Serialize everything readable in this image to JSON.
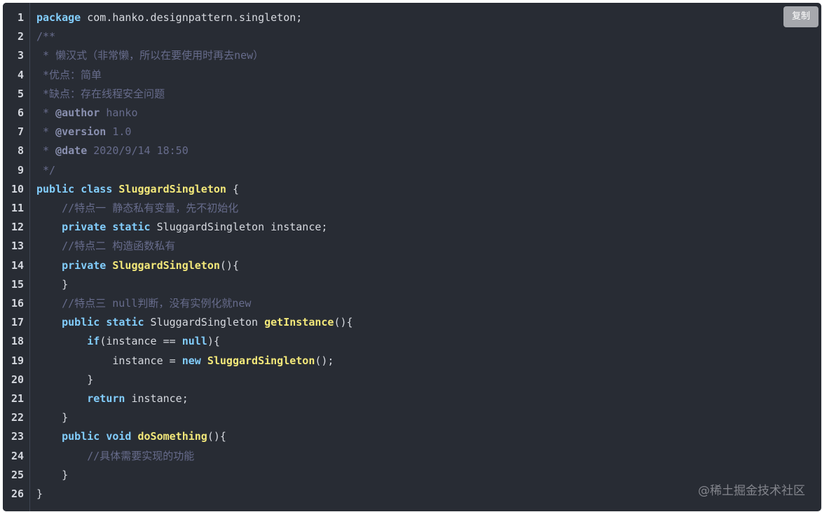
{
  "copy_button": {
    "label": "复制"
  },
  "watermark": "@稀土掘金技术社区",
  "colors": {
    "background": "#282c34",
    "keyword": "#82cdfc",
    "function": "#f3e87a",
    "comment": "#676c8c",
    "plain": "#d7dae0"
  },
  "code": {
    "language": "java",
    "lines": [
      {
        "n": "1",
        "tokens": [
          {
            "t": "package",
            "c": "kw"
          },
          {
            "t": " com.hanko.designpattern.singleton;",
            "c": "pl"
          }
        ]
      },
      {
        "n": "2",
        "tokens": [
          {
            "t": "/**",
            "c": "cm"
          }
        ]
      },
      {
        "n": "3",
        "tokens": [
          {
            "t": " * 懒汉式（非常懒，所以在要使用时再去new）",
            "c": "cm"
          }
        ]
      },
      {
        "n": "4",
        "tokens": [
          {
            "t": " *优点：简单",
            "c": "cm"
          }
        ]
      },
      {
        "n": "5",
        "tokens": [
          {
            "t": " *缺点：存在线程安全问题",
            "c": "cm"
          }
        ]
      },
      {
        "n": "6",
        "tokens": [
          {
            "t": " * ",
            "c": "cm"
          },
          {
            "t": "@author",
            "c": "tag"
          },
          {
            "t": " hanko",
            "c": "cm"
          }
        ]
      },
      {
        "n": "7",
        "tokens": [
          {
            "t": " * ",
            "c": "cm"
          },
          {
            "t": "@version",
            "c": "tag"
          },
          {
            "t": " 1.0",
            "c": "cm"
          }
        ]
      },
      {
        "n": "8",
        "tokens": [
          {
            "t": " * ",
            "c": "cm"
          },
          {
            "t": "@date",
            "c": "tag"
          },
          {
            "t": " 2020/9/14 18:50",
            "c": "cm"
          }
        ]
      },
      {
        "n": "9",
        "tokens": [
          {
            "t": " */",
            "c": "cm"
          }
        ]
      },
      {
        "n": "10",
        "tokens": [
          {
            "t": "public",
            "c": "kw"
          },
          {
            "t": " ",
            "c": "pl"
          },
          {
            "t": "class",
            "c": "kw"
          },
          {
            "t": " ",
            "c": "pl"
          },
          {
            "t": "SluggardSingleton",
            "c": "fn"
          },
          {
            "t": " {",
            "c": "pl"
          }
        ]
      },
      {
        "n": "11",
        "tokens": [
          {
            "t": "    ",
            "c": "pl"
          },
          {
            "t": "//特点一 静态私有变量，先不初始化",
            "c": "cm"
          }
        ]
      },
      {
        "n": "12",
        "tokens": [
          {
            "t": "    ",
            "c": "pl"
          },
          {
            "t": "private",
            "c": "kw"
          },
          {
            "t": " ",
            "c": "pl"
          },
          {
            "t": "static",
            "c": "kw"
          },
          {
            "t": " SluggardSingleton instance;",
            "c": "pl"
          }
        ]
      },
      {
        "n": "13",
        "tokens": [
          {
            "t": "    ",
            "c": "pl"
          },
          {
            "t": "//特点二 构造函数私有",
            "c": "cm"
          }
        ]
      },
      {
        "n": "14",
        "tokens": [
          {
            "t": "    ",
            "c": "pl"
          },
          {
            "t": "private",
            "c": "kw"
          },
          {
            "t": " ",
            "c": "pl"
          },
          {
            "t": "SluggardSingleton",
            "c": "fn"
          },
          {
            "t": "(){",
            "c": "pl"
          }
        ]
      },
      {
        "n": "15",
        "tokens": [
          {
            "t": "    }",
            "c": "pl"
          }
        ]
      },
      {
        "n": "16",
        "tokens": [
          {
            "t": "    ",
            "c": "pl"
          },
          {
            "t": "//特点三 null判断，没有实例化就new",
            "c": "cm"
          }
        ]
      },
      {
        "n": "17",
        "tokens": [
          {
            "t": "    ",
            "c": "pl"
          },
          {
            "t": "public",
            "c": "kw"
          },
          {
            "t": " ",
            "c": "pl"
          },
          {
            "t": "static",
            "c": "kw"
          },
          {
            "t": " SluggardSingleton ",
            "c": "pl"
          },
          {
            "t": "getInstance",
            "c": "fn"
          },
          {
            "t": "(){",
            "c": "pl"
          }
        ]
      },
      {
        "n": "18",
        "tokens": [
          {
            "t": "        ",
            "c": "pl"
          },
          {
            "t": "if",
            "c": "kw"
          },
          {
            "t": "(instance == ",
            "c": "pl"
          },
          {
            "t": "null",
            "c": "kw"
          },
          {
            "t": "){",
            "c": "pl"
          }
        ]
      },
      {
        "n": "19",
        "tokens": [
          {
            "t": "            instance = ",
            "c": "pl"
          },
          {
            "t": "new",
            "c": "kw"
          },
          {
            "t": " ",
            "c": "pl"
          },
          {
            "t": "SluggardSingleton",
            "c": "fn"
          },
          {
            "t": "();",
            "c": "pl"
          }
        ]
      },
      {
        "n": "20",
        "tokens": [
          {
            "t": "        }",
            "c": "pl"
          }
        ]
      },
      {
        "n": "21",
        "tokens": [
          {
            "t": "        ",
            "c": "pl"
          },
          {
            "t": "return",
            "c": "kw"
          },
          {
            "t": " instance;",
            "c": "pl"
          }
        ]
      },
      {
        "n": "22",
        "tokens": [
          {
            "t": "    }",
            "c": "pl"
          }
        ]
      },
      {
        "n": "23",
        "tokens": [
          {
            "t": "    ",
            "c": "pl"
          },
          {
            "t": "public",
            "c": "kw"
          },
          {
            "t": " ",
            "c": "pl"
          },
          {
            "t": "void",
            "c": "kw"
          },
          {
            "t": " ",
            "c": "pl"
          },
          {
            "t": "doSomething",
            "c": "fn"
          },
          {
            "t": "(){",
            "c": "pl"
          }
        ]
      },
      {
        "n": "24",
        "tokens": [
          {
            "t": "        ",
            "c": "pl"
          },
          {
            "t": "//具体需要实现的功能",
            "c": "cm"
          }
        ]
      },
      {
        "n": "25",
        "tokens": [
          {
            "t": "    }",
            "c": "pl"
          }
        ]
      },
      {
        "n": "26",
        "tokens": [
          {
            "t": "}",
            "c": "pl"
          }
        ]
      }
    ]
  }
}
